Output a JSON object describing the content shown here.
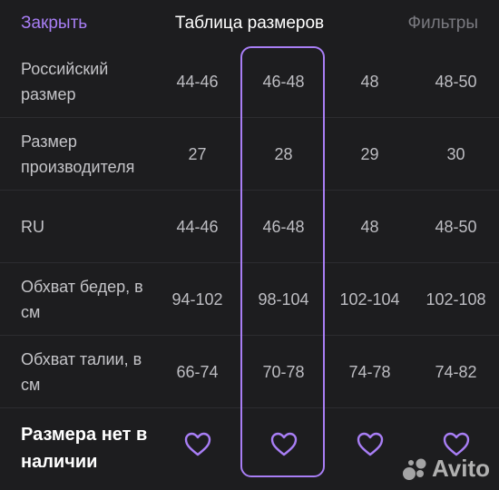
{
  "header": {
    "close_label": "Закрыть",
    "title": "Таблица размеров",
    "filters_label": "Фильтры"
  },
  "rows": [
    {
      "label": "Российский размер",
      "values": [
        "44-46",
        "46-48",
        "48",
        "48-50"
      ]
    },
    {
      "label": "Размер производителя",
      "values": [
        "27",
        "28",
        "29",
        "30"
      ]
    },
    {
      "label": "RU",
      "values": [
        "44-46",
        "46-48",
        "48",
        "48-50"
      ]
    },
    {
      "label": "Обхват бедер, в см",
      "values": [
        "94-102",
        "98-104",
        "102-104",
        "102-108"
      ]
    },
    {
      "label": "Обхват талии, в см",
      "values": [
        "66-74",
        "70-78",
        "74-78",
        "74-82"
      ]
    }
  ],
  "footer_row": {
    "label": "Размера нет в наличии",
    "heart_icons": [
      "heart-icon",
      "heart-icon",
      "heart-icon",
      "heart-icon"
    ]
  },
  "selected_column_index": 1,
  "watermark": {
    "text": "Avito"
  },
  "colors": {
    "accent": "#a87ef5",
    "background": "#1d1d1f",
    "text": "#bdbdc2",
    "title": "#ffffff",
    "muted": "#7a7a80"
  }
}
